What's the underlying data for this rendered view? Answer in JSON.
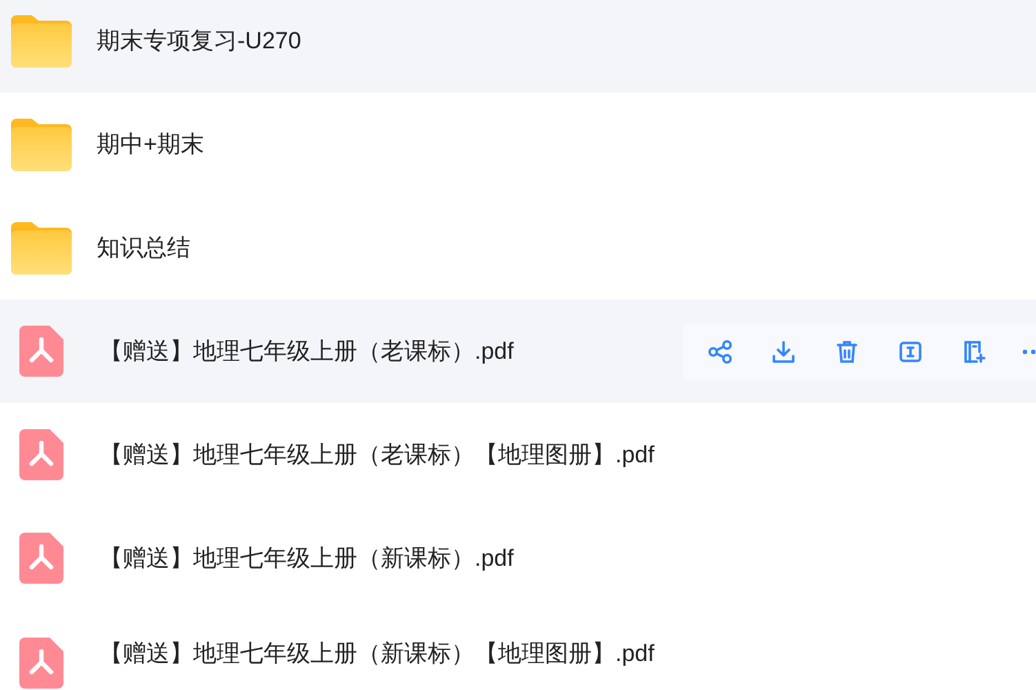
{
  "files": [
    {
      "kind": "folder",
      "name": "期末专项复习-U270",
      "selected": true
    },
    {
      "kind": "folder",
      "name": "期中+期末",
      "selected": false
    },
    {
      "kind": "folder",
      "name": "知识总结",
      "selected": false
    },
    {
      "kind": "pdf",
      "name": "【赠送】地理七年级上册（老课标）.pdf",
      "selected": true,
      "actions": [
        {
          "kind": "share"
        },
        {
          "kind": "download"
        },
        {
          "kind": "delete"
        },
        {
          "kind": "rename"
        },
        {
          "kind": "copy"
        },
        {
          "kind": "more"
        }
      ]
    },
    {
      "kind": "pdf",
      "name": "【赠送】地理七年级上册（老课标）【地理图册】.pdf",
      "selected": false
    },
    {
      "kind": "pdf",
      "name": "【赠送】地理七年级上册（新课标）.pdf",
      "selected": false
    },
    {
      "kind": "pdf",
      "name": "【赠送】地理七年级上册（新课标）【地理图册】.pdf",
      "selected": false
    }
  ]
}
